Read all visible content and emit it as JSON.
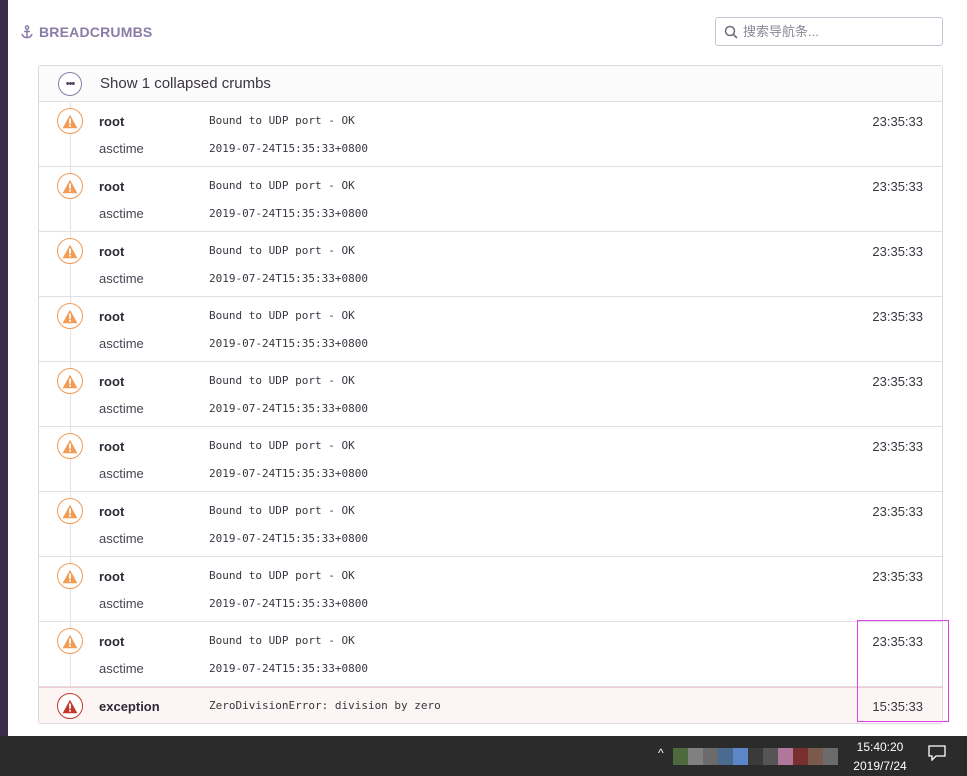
{
  "header": {
    "title": "BREADCRUMBS"
  },
  "search": {
    "placeholder": "搜索导航条..."
  },
  "collapsed": {
    "label": "Show 1 collapsed crumbs"
  },
  "crumbs": [
    {
      "category": "root",
      "message": "Bound to UDP port - OK",
      "data_key": "asctime",
      "data_value": "2019-07-24T15:35:33+0800",
      "time": "23:35:33",
      "level": "warning"
    },
    {
      "category": "root",
      "message": "Bound to UDP port - OK",
      "data_key": "asctime",
      "data_value": "2019-07-24T15:35:33+0800",
      "time": "23:35:33",
      "level": "warning"
    },
    {
      "category": "root",
      "message": "Bound to UDP port - OK",
      "data_key": "asctime",
      "data_value": "2019-07-24T15:35:33+0800",
      "time": "23:35:33",
      "level": "warning"
    },
    {
      "category": "root",
      "message": "Bound to UDP port - OK",
      "data_key": "asctime",
      "data_value": "2019-07-24T15:35:33+0800",
      "time": "23:35:33",
      "level": "warning"
    },
    {
      "category": "root",
      "message": "Bound to UDP port - OK",
      "data_key": "asctime",
      "data_value": "2019-07-24T15:35:33+0800",
      "time": "23:35:33",
      "level": "warning"
    },
    {
      "category": "root",
      "message": "Bound to UDP port - OK",
      "data_key": "asctime",
      "data_value": "2019-07-24T15:35:33+0800",
      "time": "23:35:33",
      "level": "warning"
    },
    {
      "category": "root",
      "message": "Bound to UDP port - OK",
      "data_key": "asctime",
      "data_value": "2019-07-24T15:35:33+0800",
      "time": "23:35:33",
      "level": "warning"
    },
    {
      "category": "root",
      "message": "Bound to UDP port - OK",
      "data_key": "asctime",
      "data_value": "2019-07-24T15:35:33+0800",
      "time": "23:35:33",
      "level": "warning"
    },
    {
      "category": "root",
      "message": "Bound to UDP port - OK",
      "data_key": "asctime",
      "data_value": "2019-07-24T15:35:33+0800",
      "time": "23:35:33",
      "level": "warning"
    }
  ],
  "exception": {
    "category": "exception",
    "message": "ZeroDivisionError: division by zero",
    "time": "15:35:33",
    "level": "error"
  },
  "taskbar": {
    "time": "15:40:20",
    "date": "2019/7/24"
  },
  "colors": {
    "accent": "#8a7ca6",
    "warning": "#f19b55",
    "error": "#c0392b",
    "sidebar": "#3b2b4a",
    "highlight": "#e040e8",
    "taskbar": "#2b2b2b"
  },
  "tray_colors": [
    "#4d6a3c",
    "#808080",
    "#6b6b6b",
    "#4a6a8f",
    "#5b87c9",
    "#3a3a3a",
    "#555555",
    "#b1779a",
    "#7a2f2f",
    "#7a5a4a",
    "#6b6b6b"
  ]
}
